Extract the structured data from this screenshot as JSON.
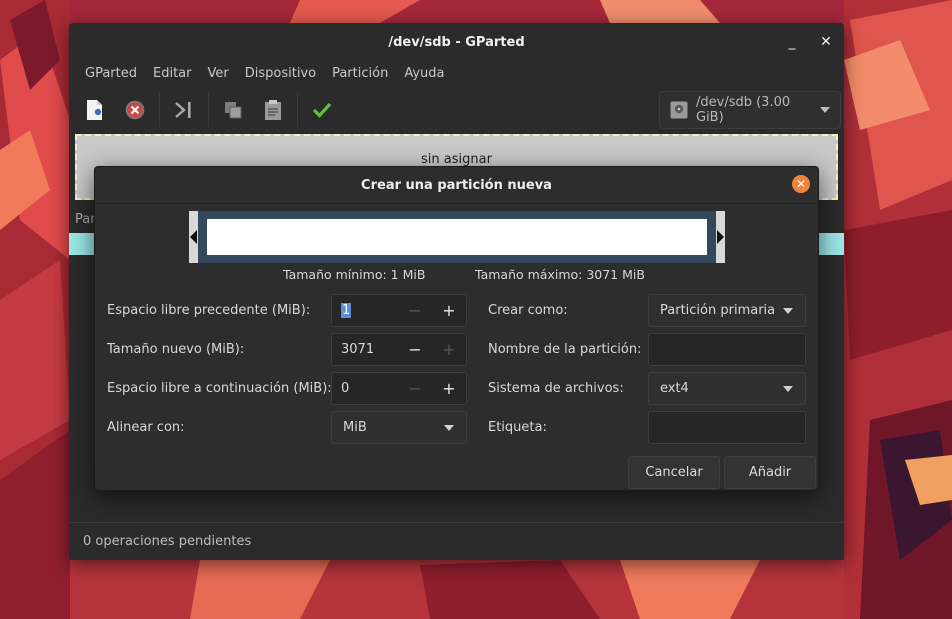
{
  "window": {
    "title": "/dev/sdb - GParted",
    "minimize_glyph": "_",
    "close_glyph": "✕"
  },
  "menubar": {
    "items": [
      "GParted",
      "Editar",
      "Ver",
      "Dispositivo",
      "Partición",
      "Ayuda"
    ]
  },
  "toolbar": {
    "icons": [
      "new-partition-icon",
      "delete-icon",
      "resize-move-icon",
      "copy-icon",
      "paste-icon",
      "apply-icon"
    ],
    "device_selector": "/dev/sdb (3.00 GiB)"
  },
  "diskmap": {
    "label": "sin asignar"
  },
  "partition_list": {
    "header_partial": "Par"
  },
  "statusbar": {
    "text": "0 operaciones pendientes"
  },
  "dialog": {
    "title": "Crear una partición nueva",
    "min_size": "Tamaño mínimo: 1 MiB",
    "max_size": "Tamaño máximo: 3071 MiB",
    "labels": {
      "free_before": "Espacio libre precedente (MiB):",
      "new_size": "Tamaño nuevo (MiB):",
      "free_after": "Espacio libre a continuación (MiB):",
      "align": "Alinear con:",
      "create_as": "Crear como:",
      "partition_name": "Nombre de la partición:",
      "filesystem": "Sistema de archivos:",
      "label": "Etiqueta:"
    },
    "values": {
      "free_before": "1",
      "new_size": "3071",
      "free_after": "0",
      "align": "MiB",
      "create_as": "Partición primaria",
      "partition_name": "",
      "filesystem": "ext4",
      "label": ""
    },
    "spin_minus": "−",
    "spin_plus": "+",
    "buttons": {
      "cancel": "Cancelar",
      "add": "Añadir"
    }
  },
  "colors": {
    "accent_close": "#f0833a",
    "apply_green": "#5fbf3a",
    "cyan_row": "#9be6e6",
    "partition_frame": "#33485c"
  }
}
